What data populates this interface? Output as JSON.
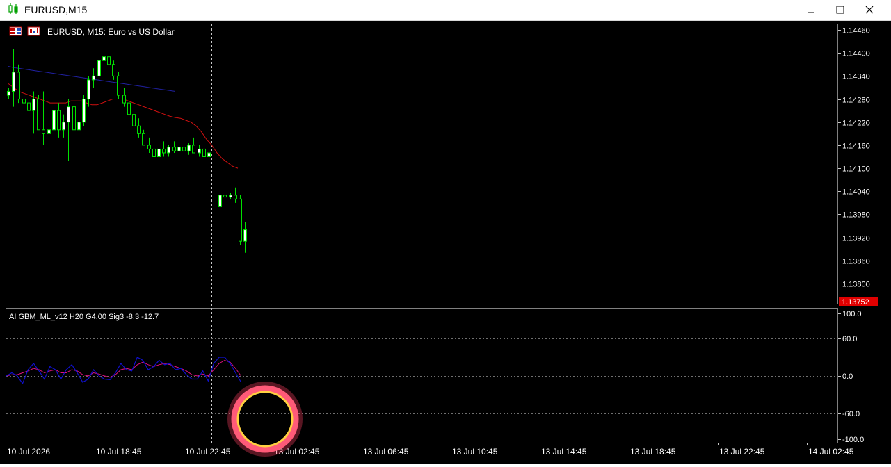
{
  "window": {
    "title": "EURUSD,M15",
    "minimize_icon": "minimize-icon",
    "maximize_icon": "maximize-icon",
    "close_icon": "close-icon"
  },
  "chart": {
    "header": "EURUSD, M15:  Euro vs US Dollar",
    "current_price": "1.13752",
    "price_ticks": [
      "1.14460",
      "1.14400",
      "1.14340",
      "1.14280",
      "1.14220",
      "1.14160",
      "1.14100",
      "1.14040",
      "1.13980",
      "1.13920",
      "1.13860",
      "1.13800"
    ],
    "time_ticks": [
      "10 Jul 2026",
      "10 Jul 18:45",
      "10 Jul 22:45",
      "13 Jul 02:45",
      "13 Jul 06:45",
      "13 Jul 10:45",
      "13 Jul 14:45",
      "13 Jul 18:45",
      "13 Jul 22:45",
      "14 Jul 02:45"
    ],
    "colors": {
      "background": "#000000",
      "grid": "#505050",
      "bull_candle": "#ffffff",
      "bear_candle": "#000000",
      "candle_outline": "#00e000",
      "ma_fast": "#d01010",
      "ma_slow": "#2020a0",
      "price_line": "#e00000"
    }
  },
  "indicator": {
    "label": "AI GBM_ML_v12 H20 G4.00 Sig3 -8.3 -12.7",
    "levels": [
      "100.0",
      "60.0",
      "0.0",
      "-60.0",
      "-100.0"
    ],
    "colors": {
      "main": "#1010d0",
      "signal": "#e01080"
    }
  },
  "chart_data": {
    "type": "candlestick",
    "title": "EURUSD, M15:  Euro vs US Dollar",
    "x_timeframe": "M15",
    "ylim": [
      1.1375,
      1.1447
    ],
    "candles": [
      {
        "o": 1.1429,
        "h": 1.1431,
        "l": 1.1428,
        "c": 1.143
      },
      {
        "o": 1.143,
        "h": 1.1441,
        "l": 1.1426,
        "c": 1.1435
      },
      {
        "o": 1.1435,
        "h": 1.1437,
        "l": 1.1427,
        "c": 1.1428
      },
      {
        "o": 1.1428,
        "h": 1.1433,
        "l": 1.1424,
        "c": 1.1427
      },
      {
        "o": 1.1427,
        "h": 1.143,
        "l": 1.1422,
        "c": 1.1425
      },
      {
        "o": 1.1425,
        "h": 1.143,
        "l": 1.1419,
        "c": 1.1428
      },
      {
        "o": 1.1428,
        "h": 1.1429,
        "l": 1.142,
        "c": 1.142
      },
      {
        "o": 1.142,
        "h": 1.143,
        "l": 1.1416,
        "c": 1.1419
      },
      {
        "o": 1.1419,
        "h": 1.1424,
        "l": 1.1418,
        "c": 1.142
      },
      {
        "o": 1.142,
        "h": 1.1427,
        "l": 1.1419,
        "c": 1.1425
      },
      {
        "o": 1.1425,
        "h": 1.1427,
        "l": 1.1418,
        "c": 1.142
      },
      {
        "o": 1.142,
        "h": 1.1424,
        "l": 1.1418,
        "c": 1.1422
      },
      {
        "o": 1.1422,
        "h": 1.1428,
        "l": 1.1412,
        "c": 1.1426
      },
      {
        "o": 1.1426,
        "h": 1.1428,
        "l": 1.1418,
        "c": 1.142
      },
      {
        "o": 1.142,
        "h": 1.1424,
        "l": 1.1419,
        "c": 1.1422
      },
      {
        "o": 1.1422,
        "h": 1.1429,
        "l": 1.1421,
        "c": 1.1428
      },
      {
        "o": 1.1428,
        "h": 1.1434,
        "l": 1.1426,
        "c": 1.1433
      },
      {
        "o": 1.1433,
        "h": 1.1436,
        "l": 1.1431,
        "c": 1.1434
      },
      {
        "o": 1.1434,
        "h": 1.1439,
        "l": 1.1433,
        "c": 1.1438
      },
      {
        "o": 1.1438,
        "h": 1.144,
        "l": 1.1436,
        "c": 1.1439
      },
      {
        "o": 1.1439,
        "h": 1.1441,
        "l": 1.1436,
        "c": 1.1437
      },
      {
        "o": 1.1437,
        "h": 1.1438,
        "l": 1.1433,
        "c": 1.1434
      },
      {
        "o": 1.1434,
        "h": 1.1435,
        "l": 1.1428,
        "c": 1.1429
      },
      {
        "o": 1.1429,
        "h": 1.1431,
        "l": 1.1426,
        "c": 1.1427
      },
      {
        "o": 1.1427,
        "h": 1.1429,
        "l": 1.1423,
        "c": 1.1424
      },
      {
        "o": 1.1424,
        "h": 1.1426,
        "l": 1.142,
        "c": 1.1421
      },
      {
        "o": 1.1421,
        "h": 1.1423,
        "l": 1.1418,
        "c": 1.1419
      },
      {
        "o": 1.1419,
        "h": 1.142,
        "l": 1.1416,
        "c": 1.1416
      },
      {
        "o": 1.1416,
        "h": 1.1418,
        "l": 1.1414,
        "c": 1.1415
      },
      {
        "o": 1.1415,
        "h": 1.1416,
        "l": 1.1412,
        "c": 1.1413
      },
      {
        "o": 1.1413,
        "h": 1.1416,
        "l": 1.1411,
        "c": 1.1415
      },
      {
        "o": 1.1415,
        "h": 1.1417,
        "l": 1.1413,
        "c": 1.1414
      },
      {
        "o": 1.1414,
        "h": 1.1416,
        "l": 1.1413,
        "c": 1.14155
      },
      {
        "o": 1.14155,
        "h": 1.1417,
        "l": 1.1414,
        "c": 1.14145
      },
      {
        "o": 1.14145,
        "h": 1.14165,
        "l": 1.1413,
        "c": 1.14155
      },
      {
        "o": 1.14155,
        "h": 1.1417,
        "l": 1.1414,
        "c": 1.14145
      },
      {
        "o": 1.14145,
        "h": 1.14165,
        "l": 1.14135,
        "c": 1.1416
      },
      {
        "o": 1.1416,
        "h": 1.1418,
        "l": 1.1414,
        "c": 1.1414
      },
      {
        "o": 1.1414,
        "h": 1.1416,
        "l": 1.1413,
        "c": 1.1415
      },
      {
        "o": 1.1415,
        "h": 1.1416,
        "l": 1.1412,
        "c": 1.1413
      },
      {
        "o": 1.1413,
        "h": 1.1415,
        "l": 1.1411,
        "c": 1.1414
      },
      {
        "o": 1.14,
        "h": 1.1406,
        "l": 1.1399,
        "c": 1.1403
      },
      {
        "o": 1.1403,
        "h": 1.1404,
        "l": 1.1402,
        "c": 1.14025
      },
      {
        "o": 1.14025,
        "h": 1.14035,
        "l": 1.1402,
        "c": 1.1403
      },
      {
        "o": 1.1403,
        "h": 1.1405,
        "l": 1.1401,
        "c": 1.1402
      },
      {
        "o": 1.1402,
        "h": 1.1403,
        "l": 1.139,
        "c": 1.1391
      },
      {
        "o": 1.1391,
        "h": 1.1396,
        "l": 1.1388,
        "c": 1.1394
      }
    ],
    "ma_fast": [
      1.1432,
      1.1431,
      1.143,
      1.14295,
      1.1429,
      1.14285,
      1.1428,
      1.14275,
      1.1427,
      1.1427,
      1.1427,
      1.1427,
      1.14275,
      1.14275,
      1.14275,
      1.1427,
      1.14265,
      1.14265,
      1.1427,
      1.14275,
      1.1428,
      1.1428,
      1.1428,
      1.14275,
      1.1427,
      1.14265,
      1.1426,
      1.14255,
      1.1425,
      1.14245,
      1.1424,
      1.14235,
      1.14232,
      1.1423,
      1.14225,
      1.1422,
      1.1421,
      1.14195,
      1.14175,
      1.1416,
      1.1414,
      1.14125,
      1.14115,
      1.14105,
      1.141
    ],
    "ma_slow": [
      1.14365,
      1.14362,
      1.1436,
      1.14358,
      1.14356,
      1.14354,
      1.14352,
      1.1435,
      1.14348,
      1.14346,
      1.14344,
      1.14342,
      1.1434,
      1.14338,
      1.14336,
      1.14334,
      1.14332,
      1.1433,
      1.14328,
      1.14326,
      1.14324,
      1.14322,
      1.1432,
      1.14318,
      1.14316,
      1.14314,
      1.14312,
      1.1431,
      1.14308,
      1.14306,
      1.14304,
      1.14302,
      1.143
    ],
    "indicator_main": [
      0,
      5,
      0,
      -12,
      10,
      20,
      8,
      -5,
      15,
      10,
      -5,
      10,
      18,
      5,
      -10,
      -5,
      10,
      0,
      -5,
      -6,
      5,
      20,
      10,
      8,
      30,
      25,
      10,
      15,
      25,
      18,
      20,
      10,
      12,
      2,
      -5,
      -5,
      8,
      -8,
      20,
      30,
      30,
      20,
      5,
      -10
    ],
    "indicator_signal": [
      0,
      2,
      2,
      5,
      8,
      12,
      10,
      5,
      8,
      10,
      5,
      5,
      10,
      8,
      2,
      0,
      5,
      3,
      0,
      -2,
      2,
      10,
      12,
      10,
      18,
      22,
      18,
      15,
      18,
      20,
      18,
      15,
      12,
      8,
      2,
      0,
      3,
      0,
      10,
      20,
      25,
      22,
      12,
      0
    ],
    "indicator_ylim": [
      -100,
      100
    ]
  }
}
